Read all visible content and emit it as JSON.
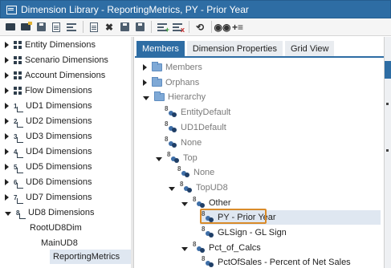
{
  "window": {
    "title": "Dimension Library - ReportingMetrics, PY - Prior Year"
  },
  "toolbar": {
    "buttons": [
      {
        "icon": "new-folder-icon"
      },
      {
        "icon": "open-folder-icon"
      },
      {
        "icon": "save-icon"
      },
      {
        "icon": "edit-document-icon"
      },
      {
        "icon": "dimension-list-icon"
      },
      {
        "icon": "copy-icon"
      },
      {
        "icon": "delete-icon"
      },
      {
        "icon": "save-all-icon"
      },
      {
        "icon": "print-icon"
      },
      {
        "icon": "add-member-icon"
      },
      {
        "icon": "remove-member-icon"
      },
      {
        "icon": "refresh-icon"
      },
      {
        "icon": "search-icon"
      },
      {
        "icon": "move-icon"
      }
    ]
  },
  "left_tree": {
    "items": [
      {
        "label": "Entity Dimensions",
        "state": "collapsed",
        "icon": "dimension-icon"
      },
      {
        "label": "Scenario Dimensions",
        "state": "collapsed",
        "icon": "dimension-icon"
      },
      {
        "label": "Account Dimensions",
        "state": "collapsed",
        "icon": "dimension-icon"
      },
      {
        "label": "Flow Dimensions",
        "state": "collapsed",
        "icon": "dimension-icon"
      },
      {
        "label": "UD1 Dimensions",
        "state": "collapsed",
        "icon": "ud-icon",
        "num": "1"
      },
      {
        "label": "UD2 Dimensions",
        "state": "collapsed",
        "icon": "ud-icon",
        "num": "2"
      },
      {
        "label": "UD3 Dimensions",
        "state": "collapsed",
        "icon": "ud-icon",
        "num": "3"
      },
      {
        "label": "UD4 Dimensions",
        "state": "collapsed",
        "icon": "ud-icon",
        "num": "4"
      },
      {
        "label": "UD5 Dimensions",
        "state": "collapsed",
        "icon": "ud-icon",
        "num": "5"
      },
      {
        "label": "UD6 Dimensions",
        "state": "collapsed",
        "icon": "ud-icon",
        "num": "6"
      },
      {
        "label": "UD7 Dimensions",
        "state": "collapsed",
        "icon": "ud-icon",
        "num": "7"
      },
      {
        "label": "UD8 Dimensions",
        "state": "expanded",
        "icon": "ud-icon",
        "num": "8"
      },
      {
        "label": "RootUD8Dim",
        "state": "none"
      },
      {
        "label": "MainUD8",
        "state": "none"
      },
      {
        "label": "ReportingMetrics",
        "state": "none",
        "selected": true
      }
    ]
  },
  "tabs": [
    {
      "label": "Members",
      "active": true
    },
    {
      "label": "Dimension Properties",
      "active": false
    },
    {
      "label": "Grid View",
      "active": false
    }
  ],
  "member_tree": {
    "items": [
      {
        "label": "Members",
        "type": "folder",
        "state": "collapsed",
        "style": "gray"
      },
      {
        "label": "Orphans",
        "type": "folder",
        "state": "collapsed",
        "style": "gray"
      },
      {
        "label": "Hierarchy",
        "type": "folder",
        "state": "expanded",
        "style": "gray"
      },
      {
        "label": "EntityDefault",
        "type": "member",
        "state": "none",
        "style": "gray"
      },
      {
        "label": "UD1Default",
        "type": "member",
        "state": "none",
        "style": "gray"
      },
      {
        "label": "None",
        "type": "member",
        "state": "none",
        "style": "gray"
      },
      {
        "label": "Top",
        "type": "member",
        "state": "expanded",
        "style": "gray"
      },
      {
        "label": "None",
        "type": "member",
        "state": "none",
        "style": "gray"
      },
      {
        "label": "TopUD8",
        "type": "member",
        "state": "expanded",
        "style": "gray"
      },
      {
        "label": "Other",
        "type": "member",
        "state": "expanded",
        "style": "dark"
      },
      {
        "label": "PY - Prior Year",
        "type": "member",
        "state": "none",
        "style": "dark",
        "selected": true
      },
      {
        "label": "GLSign - GL Sign",
        "type": "member",
        "state": "none",
        "style": "dark"
      },
      {
        "label": "Pct_of_Calcs",
        "type": "member",
        "state": "expanded",
        "style": "dark"
      },
      {
        "label": "PctOfSales - Percent of Net Sales",
        "type": "member",
        "state": "none",
        "style": "dark"
      }
    ]
  },
  "colors": {
    "titlebar": "#2e6da4",
    "selection": "#dfe7f1",
    "highlight_outline": "#d98b2a"
  }
}
